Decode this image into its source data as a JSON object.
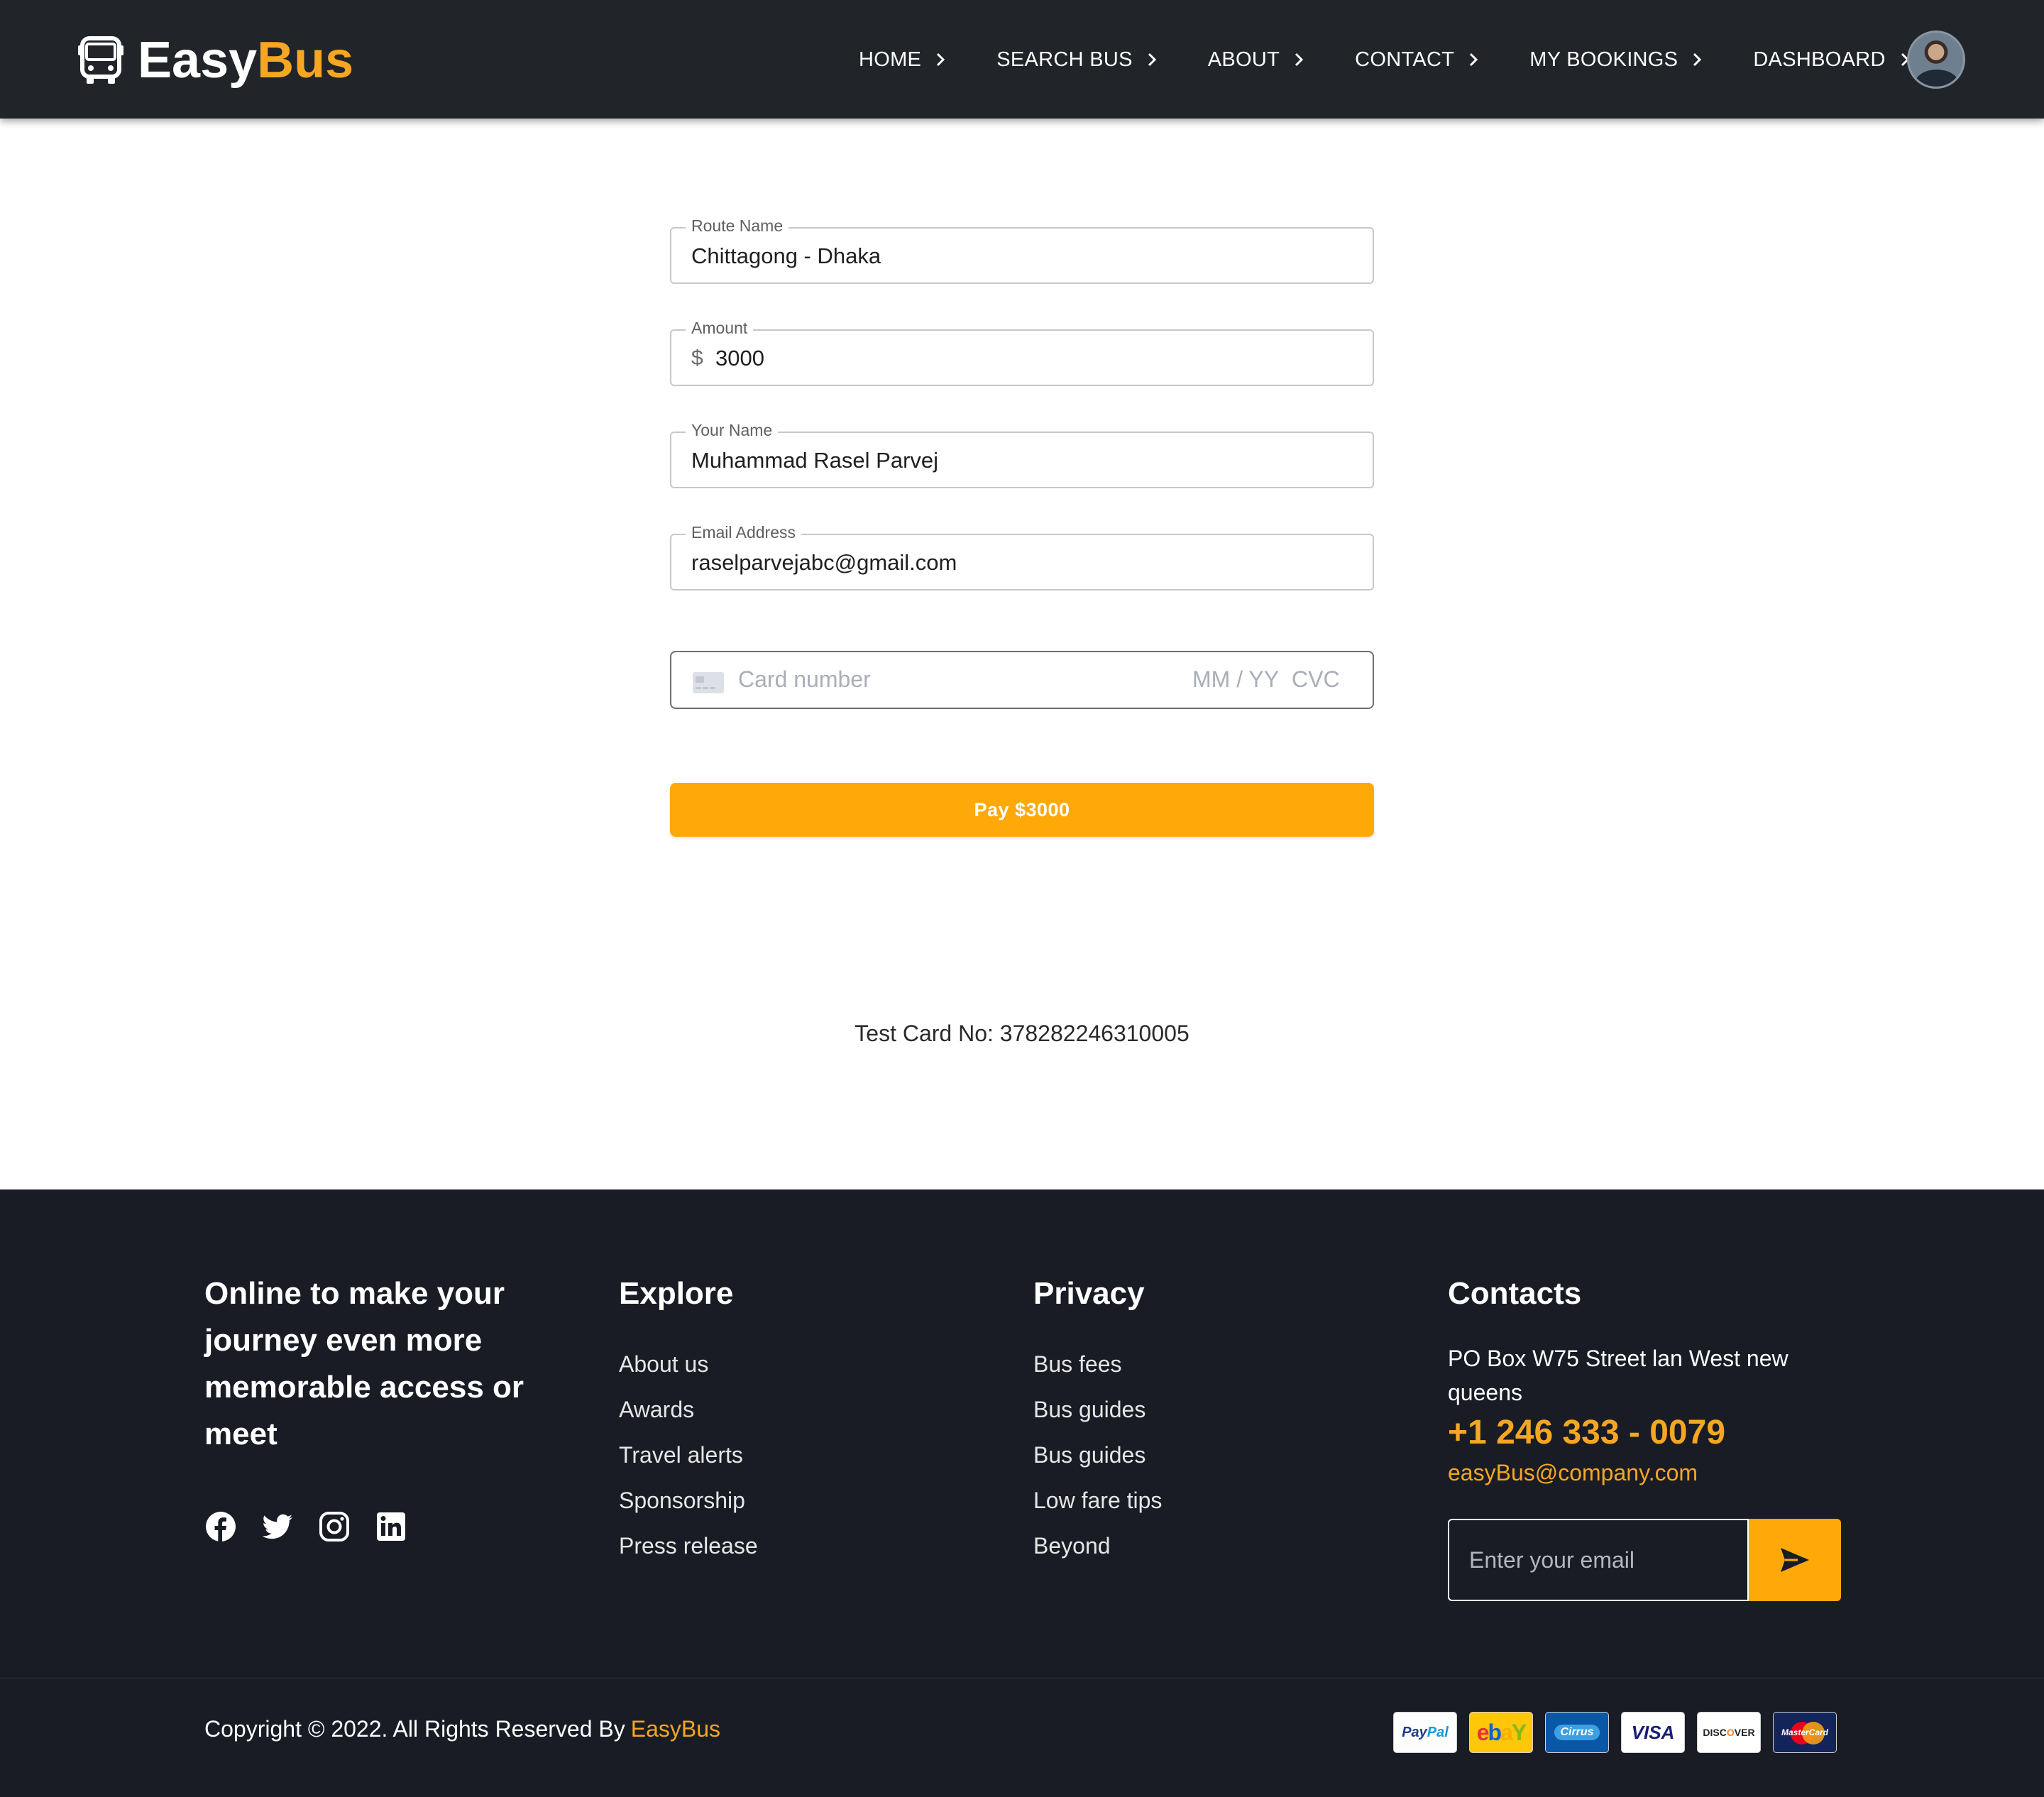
{
  "brand": {
    "name_part1": "Easy",
    "name_part2": "Bus",
    "icon": "bus-icon",
    "accent_color": "#f5a623"
  },
  "nav": {
    "items": [
      {
        "label": "HOME"
      },
      {
        "label": "SEARCH BUS"
      },
      {
        "label": "ABOUT"
      },
      {
        "label": "CONTACT"
      },
      {
        "label": "MY BOOKINGS"
      },
      {
        "label": "DASHBOARD"
      }
    ],
    "chevron_icon": "chevron-right-icon",
    "avatar_icon": "user-avatar"
  },
  "form": {
    "route": {
      "label": "Route Name",
      "value": "Chittagong - Dhaka"
    },
    "amount": {
      "label": "Amount",
      "prefix": "$",
      "value": "3000"
    },
    "name": {
      "label": "Your Name",
      "value": "Muhammad Rasel Parvej"
    },
    "email": {
      "label": "Email Address",
      "value": "raselparvejabc@gmail.com"
    },
    "card": {
      "placeholder": "Card number",
      "expiry_placeholder": "MM / YY",
      "cvc_placeholder": "CVC",
      "icon": "credit-card-icon"
    },
    "pay_button": "Pay $3000",
    "pay_color": "#ffa908"
  },
  "test_card": "Test Card No: 378282246310005",
  "footer": {
    "tagline": "Online to make your journey even more memorable access or meet",
    "socials": [
      "facebook-icon",
      "twitter-icon",
      "instagram-icon",
      "linkedin-icon"
    ],
    "explore": {
      "title": "Explore",
      "links": [
        "About us",
        "Awards",
        "Travel alerts",
        "Sponsorship",
        "Press release"
      ]
    },
    "privacy": {
      "title": "Privacy",
      "links": [
        "Bus fees",
        "Bus guides",
        "Bus guides",
        "Low fare tips",
        "Beyond"
      ]
    },
    "contacts": {
      "title": "Contacts",
      "address": "PO Box W75 Street lan West new queens",
      "phone": "+1 246 333 - 0079",
      "email": "easyBus@company.com",
      "subscribe_placeholder": "Enter your email",
      "send_icon": "send-icon"
    },
    "copyright": "Copyright © 2022. All Rights Reserved By",
    "copyright_brand": "EasyBus",
    "payment_methods": [
      "PayPal",
      "ebay",
      "Cirrus",
      "VISA",
      "DISCOVER",
      "MasterCard"
    ],
    "background_color": "#191c24"
  }
}
